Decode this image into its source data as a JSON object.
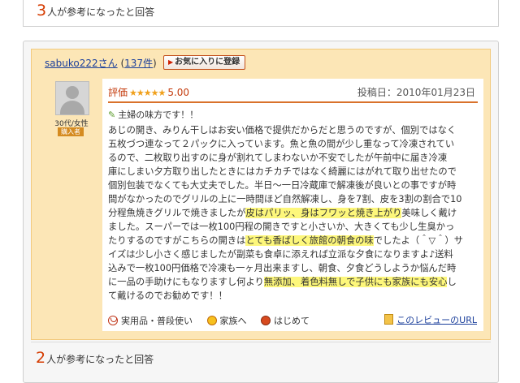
{
  "previous_review": {
    "helpful_count": "3",
    "helpful_text": "人が参考になったと回答"
  },
  "reviewer": {
    "name": "sabuko222さん",
    "review_count": "137件",
    "favorite_button": "お気に入りに登録",
    "age_gender": "30代/女性",
    "badge": "購入者"
  },
  "review": {
    "rating_label": "評価",
    "stars": "★★★★★",
    "rating_value": "5.00",
    "posted_date": "投稿日：2010年01月23日",
    "title": "主婦の味方です！！",
    "lines": [
      {
        "segments": [
          {
            "t": "あじの開き、みりん干しはお安い価格で提供だからだと思うのですが、個別ではなく"
          }
        ]
      },
      {
        "segments": [
          {
            "t": "五枚づつ連なって２パックに入っています。魚と魚の間が少し重なって冷凍されてい"
          }
        ]
      },
      {
        "segments": [
          {
            "t": "るので、二枚取り出すのに身が割れてしまわないか不安でしたが午前中に届き冷凍"
          }
        ]
      },
      {
        "segments": [
          {
            "t": "庫にしまい夕方取り出したときにはカチカチではなく綺麗にはがれて取り出せたので"
          }
        ]
      },
      {
        "segments": [
          {
            "t": "個別包装でなくても大丈夫でした。半日～一日冷蔵庫で解凍後が良いとの事ですが時"
          }
        ]
      },
      {
        "segments": [
          {
            "t": "間がなかったのでグリルの上に一時間ほど自然解凍し、身を7割、皮を3割の割合で10"
          }
        ]
      },
      {
        "segments": [
          {
            "t": "分程魚焼きグリルで焼きましたが"
          },
          {
            "t": "皮はパリッ、身はフワッと焼き上がり",
            "hl": true
          },
          {
            "t": "美味しく戴け"
          }
        ]
      },
      {
        "segments": [
          {
            "t": "ました。スーパーでは一枚100円程の開きですと小さいか、大きくても少し生臭かっ"
          }
        ]
      },
      {
        "segments": [
          {
            "t": "たりするのですがこちらの開きは"
          },
          {
            "t": "とても香ばしく旅館の朝食の味",
            "hl": true
          },
          {
            "t": "でしたよ（＾▽＾）サ"
          }
        ]
      },
      {
        "segments": [
          {
            "t": "イズは少し小さく感じましたが副菜も食卓に添えれば立派な夕食になりますよ♪送料"
          }
        ]
      },
      {
        "segments": [
          {
            "t": "込みで一枚100円価格で冷凍も一ヶ月出来ますし、朝食、夕食どうしようか悩んだ時"
          }
        ]
      },
      {
        "segments": [
          {
            "t": "に一品の手助けにもなりますし何より"
          },
          {
            "t": "無添加、着色料無しで子供にも家族にも安心",
            "hl": true
          },
          {
            "t": "し"
          }
        ]
      },
      {
        "segments": [
          {
            "t": "て戴けるのでお勧めです！！"
          }
        ]
      }
    ],
    "tags": [
      {
        "icon": "purpose-icon",
        "label": "実用品・普段使い"
      },
      {
        "icon": "family-icon",
        "label": "家族へ"
      },
      {
        "icon": "first-time-icon",
        "label": "はじめて"
      }
    ],
    "url_link": "このレビューのURL"
  },
  "footer": {
    "helpful_count": "2",
    "helpful_text": "人が参考になったと回答"
  },
  "colors": {
    "accent": "#d53b00",
    "highlight": "#fdf77b",
    "card_bg": "#fce6b6",
    "link": "#1b3f9b"
  }
}
